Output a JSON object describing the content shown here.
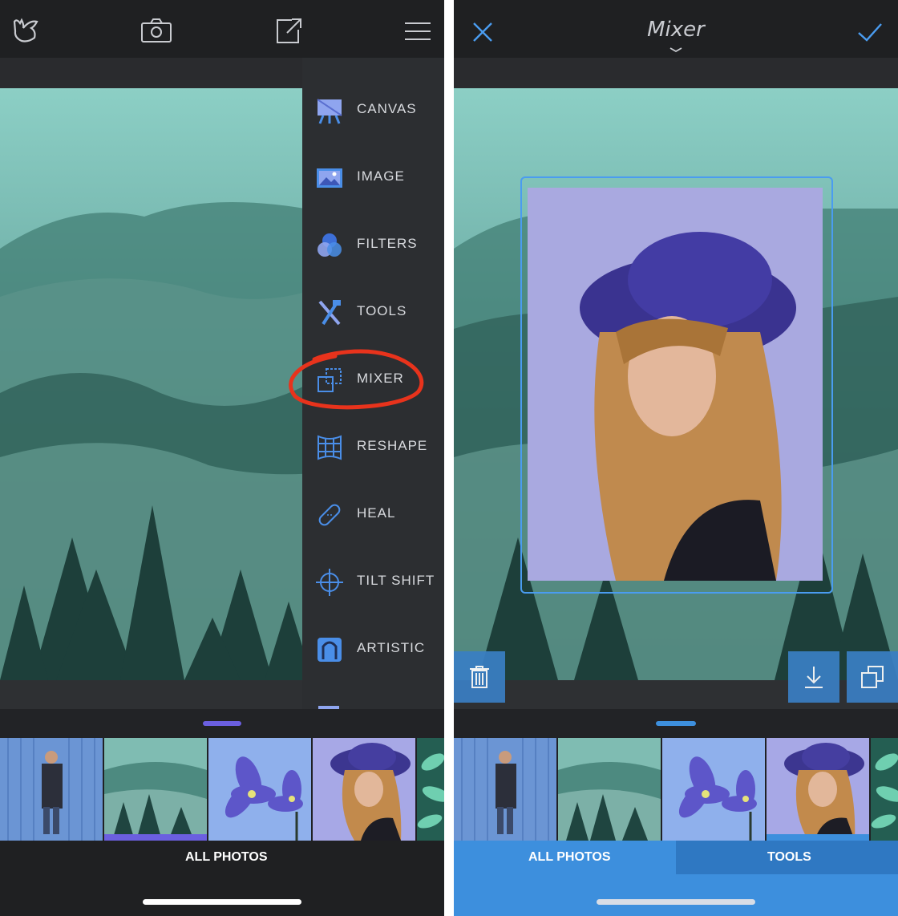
{
  "left_screen": {
    "side_menu": [
      {
        "label": "CANVAS",
        "icon": "canvas-easel-icon"
      },
      {
        "label": "IMAGE",
        "icon": "image-icon"
      },
      {
        "label": "FILTERS",
        "icon": "filters-circles-icon"
      },
      {
        "label": "TOOLS",
        "icon": "tools-icon"
      },
      {
        "label": "MIXER",
        "icon": "mixer-layers-icon"
      },
      {
        "label": "RESHAPE",
        "icon": "reshape-grid-icon"
      },
      {
        "label": "HEAL",
        "icon": "heal-bandage-icon"
      },
      {
        "label": "TILT SHIFT",
        "icon": "tilt-shift-crosshair-icon"
      },
      {
        "label": "ARTISTIC",
        "icon": "artistic-frame-icon"
      }
    ],
    "bottom_tab": "ALL PHOTOS",
    "highlighted_item": "MIXER",
    "highlight_color": "#e8331c"
  },
  "right_screen": {
    "title": "Mixer",
    "tabs": [
      "ALL PHOTOS",
      "TOOLS"
    ],
    "accent_color": "#3d8fdd"
  },
  "thumbnails": [
    "man-blue-wall",
    "foggy-forest",
    "purple-flowers",
    "woman-purple-hat",
    "green-leaves"
  ]
}
